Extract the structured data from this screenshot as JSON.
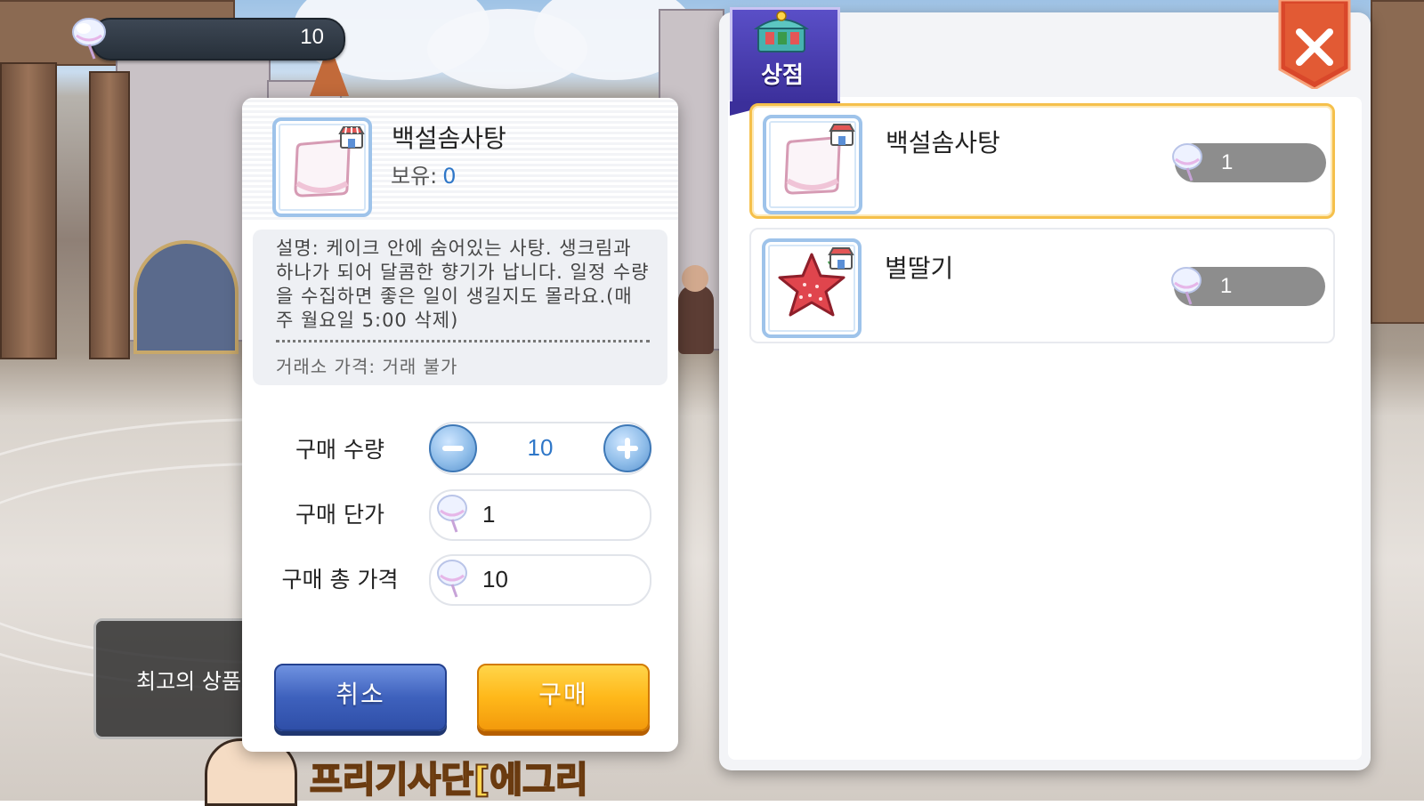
{
  "currency": {
    "amount": "10",
    "icon": "cotton-candy-icon"
  },
  "toast": {
    "text": "최고의 상품"
  },
  "banner": {
    "text": "프리기사단[에그리"
  },
  "purchase_dialog": {
    "item_name": "백설솜사탕",
    "owned_label": "보유:",
    "owned_value": "0",
    "description": "설명: 케이크 안에 숨어있는 사탕. 생크림과 하나가 되어 달콤한 향기가 납니다. 일정 수량을 수집하면 좋은 일이 생길지도 몰라요.(매주 월요일 5:00 삭제)",
    "market_price": "거래소 가격: 거래 불가",
    "quantity_label": "구매 수량",
    "quantity_value": "10",
    "unit_price_label": "구매 단가",
    "unit_price_value": "1",
    "total_price_label": "구매 총 가격",
    "total_price_value": "10",
    "cancel_label": "취소",
    "buy_label": "구매"
  },
  "shop": {
    "title": "상점",
    "items": [
      {
        "name": "백설솜사탕",
        "price": "1",
        "selected": true
      },
      {
        "name": "별딸기",
        "price": "1",
        "selected": false
      }
    ]
  },
  "colors": {
    "accent_blue": "#2f77c8",
    "buy_orange": "#ffb81a",
    "cancel_blue": "#3e61bd",
    "close_red": "#d9472a",
    "selected_border": "#f5c04b"
  }
}
